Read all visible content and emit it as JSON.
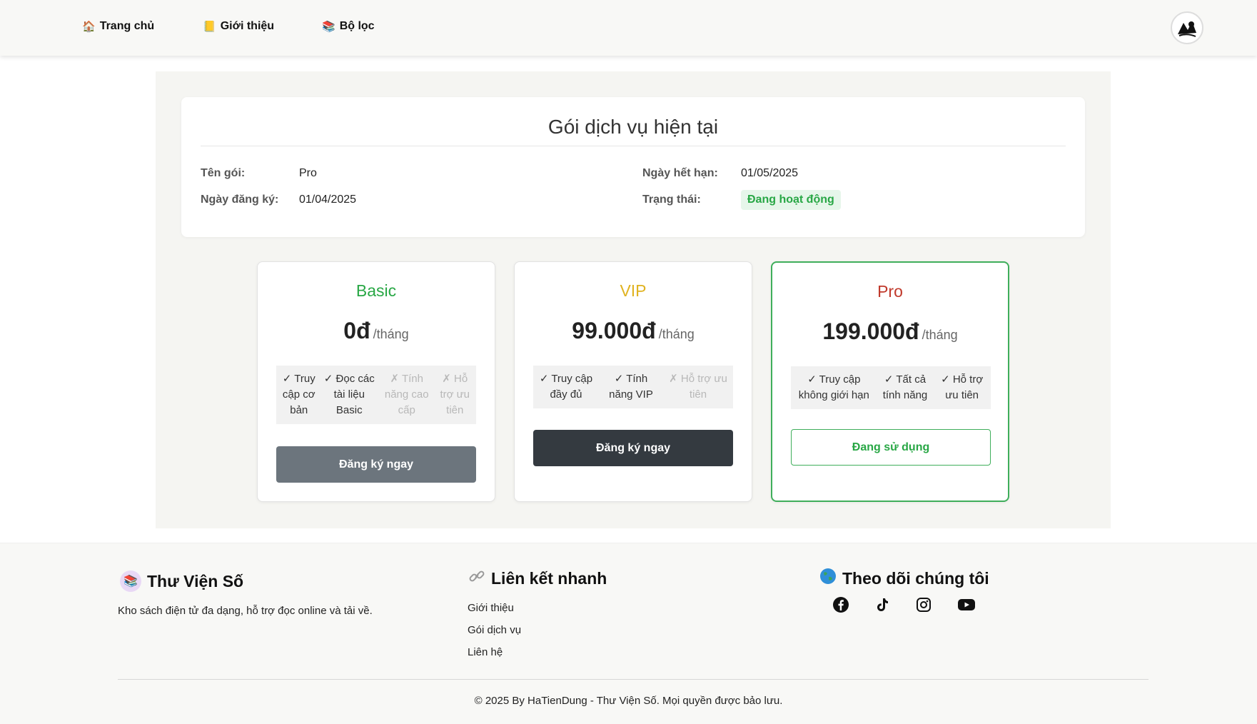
{
  "nav": {
    "home": {
      "icon": "house-icon",
      "label": "Trang chủ"
    },
    "about": {
      "icon": "notebook-icon",
      "label": "Giới thiệu"
    },
    "filter": {
      "icon": "books-icon",
      "label": "Bộ lọc"
    }
  },
  "current": {
    "title": "Gói dịch vụ hiện tại",
    "name_label": "Tên gói:",
    "name_value": "Pro",
    "reg_label": "Ngày đăng ký:",
    "reg_value": "01/04/2025",
    "exp_label": "Ngày hết hạn:",
    "exp_value": "01/05/2025",
    "status_label": "Trạng thái:",
    "status_value": "Đang hoạt động"
  },
  "plans": [
    {
      "name": "Basic",
      "name_color": "#28a745",
      "price": "0đ",
      "period": "/tháng",
      "features": [
        {
          "text": "✓ Truy cập cơ bản",
          "enabled": true
        },
        {
          "text": "✓ Đọc các tài liệu Basic",
          "enabled": true
        },
        {
          "text": "✗ Tính năng cao cấp",
          "enabled": false
        },
        {
          "text": "✗ Hỗ trợ ưu tiên",
          "enabled": false
        }
      ],
      "button": "Đăng ký ngay",
      "button_color": "#6c757d"
    },
    {
      "name": "VIP",
      "name_color": "#e0b321",
      "price": "99.000đ",
      "period": "/tháng",
      "features": [
        {
          "text": "✓ Truy cập đầy đủ",
          "enabled": true
        },
        {
          "text": "✓ Tính năng VIP",
          "enabled": true
        },
        {
          "text": "✗ Hỗ trợ ưu tiên",
          "enabled": false
        }
      ],
      "button": "Đăng ký ngay",
      "button_color": "#343a40"
    },
    {
      "name": "Pro",
      "name_color": "#c0392b",
      "price": "199.000đ",
      "period": "/tháng",
      "features": [
        {
          "text": "✓ Truy cập không giới hạn",
          "enabled": true
        },
        {
          "text": "✓ Tất cả tính năng",
          "enabled": true
        },
        {
          "text": "✓ Hỗ trợ ưu tiên",
          "enabled": true
        }
      ],
      "button": "Đang sử dụng",
      "button_color": "#3fae5b"
    }
  ],
  "footer": {
    "brand": "Thư Viện Số",
    "brand_icon": "library-icon",
    "description": "Kho sách điện tử đa dạng, hỗ trợ đọc online và tải về.",
    "links_title": "Liên kết nhanh",
    "links_icon": "link-icon",
    "links": [
      "Giới thiệu",
      "Gói dịch vụ",
      "Liên hệ"
    ],
    "follow_title": "Theo dõi chúng tôi",
    "follow_icon": "globe-icon",
    "socials": [
      "facebook-icon",
      "tiktok-icon",
      "instagram-icon",
      "youtube-icon"
    ],
    "copyright": "© 2025 By HaTienDung - Thư Viện Số. Mọi quyền được bảo lưu."
  }
}
